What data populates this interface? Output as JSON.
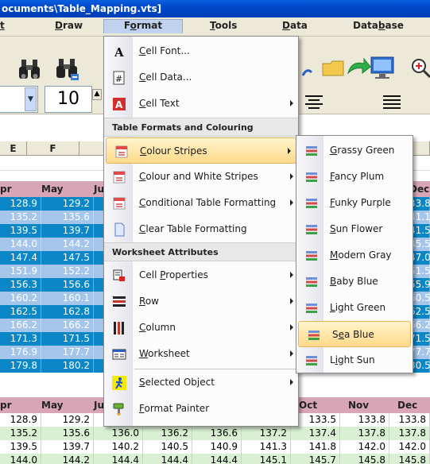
{
  "window": {
    "title": "ocuments\\Table_Mapping.vts]"
  },
  "menubar": {
    "items": [
      {
        "label_pre": "",
        "label_ul": "t",
        "label_post": ""
      },
      {
        "label_pre": "",
        "label_ul": "D",
        "label_post": "raw"
      },
      {
        "label_pre": "F",
        "label_ul": "o",
        "label_post": "rmat"
      },
      {
        "label_pre": "",
        "label_ul": "T",
        "label_post": "ools"
      },
      {
        "label_pre": "",
        "label_ul": "D",
        "label_post": "ata"
      },
      {
        "label_pre": "Data",
        "label_ul": "b",
        "label_post": "ase"
      }
    ]
  },
  "toolbar": {
    "font_size": "10"
  },
  "grid": {
    "columns": [
      "E",
      "F"
    ],
    "top_header": [
      "pr",
      "May",
      "Ju",
      "Dec"
    ],
    "top_rows": [
      [
        "128.9",
        "129.2",
        "33.8"
      ],
      [
        "135.2",
        "135.6",
        "41.1"
      ],
      [
        "139.5",
        "139.7",
        "41.5"
      ],
      [
        "144.0",
        "144.2",
        "45.5"
      ],
      [
        "147.4",
        "147.5",
        "47.0"
      ],
      [
        "151.9",
        "152.2",
        "51.5"
      ],
      [
        "156.3",
        "156.6",
        "55.9"
      ],
      [
        "160.2",
        "160.1",
        "60.5"
      ],
      [
        "162.5",
        "162.8",
        "62.5"
      ],
      [
        "166.2",
        "166.2",
        "66.2"
      ],
      [
        "171.3",
        "171.5",
        "71.5"
      ],
      [
        "176.9",
        "177.7",
        "77.7"
      ],
      [
        "179.8",
        "180.2",
        "80.5"
      ]
    ],
    "bottom_header": [
      "pr",
      "May",
      "Ju",
      "Oct",
      "Nov",
      "Dec"
    ],
    "bottom_rows": [
      [
        "128.9",
        "129.2",
        "",
        "",
        "",
        "",
        "133.5",
        "133.8",
        "133.8"
      ],
      [
        "135.2",
        "135.6",
        "136.0",
        "136.2",
        "136.6",
        "137.2",
        "137.4",
        "137.8",
        "137.8"
      ],
      [
        "139.5",
        "139.7",
        "140.2",
        "140.5",
        "140.9",
        "141.3",
        "141.8",
        "142.0",
        "142.0"
      ],
      [
        "144.0",
        "144.2",
        "144.4",
        "144.4",
        "144.4",
        "145.1",
        "145.7",
        "145.8",
        "145.8"
      ]
    ]
  },
  "format_menu": {
    "items": [
      {
        "label_pre": "",
        "label_ul": "C",
        "label_post": "ell Font...",
        "icon": "font-a-icon"
      },
      {
        "label_pre": "",
        "label_ul": "C",
        "label_post": "ell Data...",
        "icon": "hash-icon"
      },
      {
        "label_pre": "",
        "label_ul": "C",
        "label_post": "ell Text",
        "icon": "red-a-icon"
      }
    ],
    "section1": "Table Formats and Colouring",
    "items2": [
      {
        "label_pre": "",
        "label_ul": "C",
        "label_post": "olour Stripes"
      },
      {
        "label_pre": "",
        "label_ul": "C",
        "label_post": "olour and White Stripes"
      },
      {
        "label_pre": "",
        "label_ul": "C",
        "label_post": "onditional Table Formatting"
      },
      {
        "label_pre": "",
        "label_ul": "C",
        "label_post": "lear Table Formatting"
      }
    ],
    "section2": "Worksheet Attributes",
    "items3": [
      {
        "label_pre": "Cell ",
        "label_ul": "P",
        "label_post": "roperties"
      },
      {
        "label_pre": "",
        "label_ul": "R",
        "label_post": "ow"
      },
      {
        "label_pre": "",
        "label_ul": "C",
        "label_post": "olumn"
      },
      {
        "label_pre": "",
        "label_ul": "W",
        "label_post": "orksheet"
      },
      {
        "label_pre": "",
        "label_ul": "S",
        "label_post": "elected Object"
      },
      {
        "label_pre": "",
        "label_ul": "F",
        "label_post": "ormat Painter"
      }
    ]
  },
  "stripes_submenu": {
    "items": [
      {
        "label_pre": "",
        "label_ul": "G",
        "label_post": "rassy Green"
      },
      {
        "label_pre": "",
        "label_ul": "F",
        "label_post": "ancy Plum"
      },
      {
        "label_pre": "",
        "label_ul": "F",
        "label_post": "unky Purple"
      },
      {
        "label_pre": "",
        "label_ul": "S",
        "label_post": "un Flower"
      },
      {
        "label_pre": "",
        "label_ul": "M",
        "label_post": "odern Gray"
      },
      {
        "label_pre": "",
        "label_ul": "B",
        "label_post": "aby Blue"
      },
      {
        "label_pre": "",
        "label_ul": "L",
        "label_post": "ight Green"
      },
      {
        "label_pre": "S",
        "label_ul": "e",
        "label_post": "a Blue"
      },
      {
        "label_pre": "L",
        "label_ul": "i",
        "label_post": "ght Sun"
      }
    ]
  }
}
